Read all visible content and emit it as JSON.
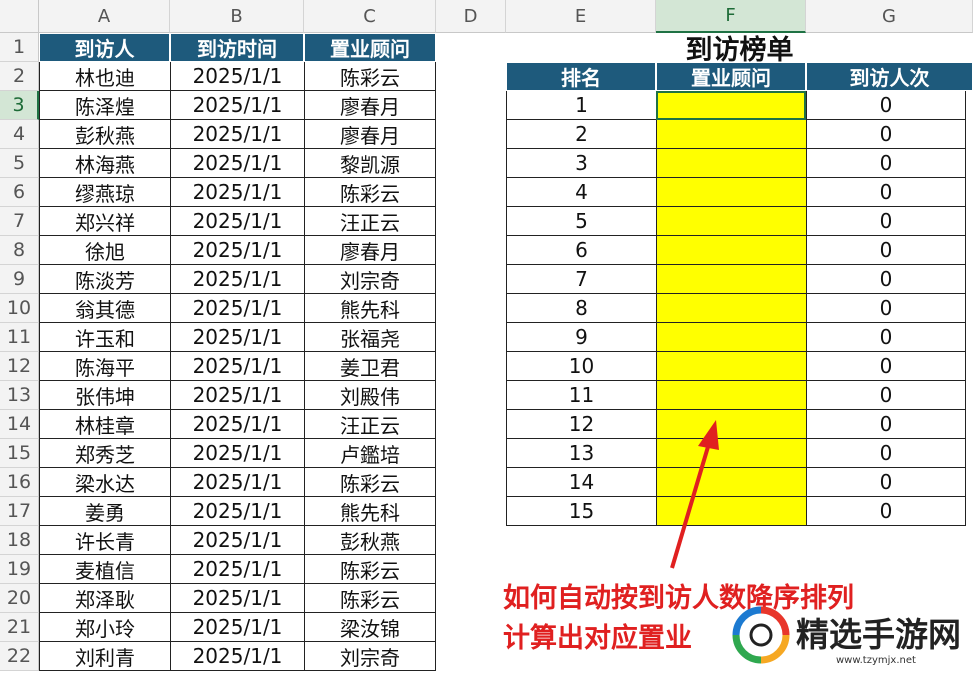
{
  "columns": [
    "A",
    "B",
    "C",
    "D",
    "E",
    "F",
    "G"
  ],
  "selected_column": "F",
  "selected_row": "3",
  "rows": [
    "1",
    "2",
    "3",
    "4",
    "5",
    "6",
    "7",
    "8",
    "9",
    "10",
    "11",
    "12",
    "13",
    "14",
    "15",
    "16",
    "17",
    "18",
    "19",
    "20",
    "21",
    "22"
  ],
  "left_table": {
    "headers": [
      "到访人",
      "到访时间",
      "置业顾问"
    ],
    "rows": [
      [
        "林也迪",
        "2025/1/1",
        "陈彩云"
      ],
      [
        "陈泽煌",
        "2025/1/1",
        "廖春月"
      ],
      [
        "彭秋燕",
        "2025/1/1",
        "廖春月"
      ],
      [
        "林海燕",
        "2025/1/1",
        "黎凯源"
      ],
      [
        "缪燕琼",
        "2025/1/1",
        "陈彩云"
      ],
      [
        "郑兴祥",
        "2025/1/1",
        "汪正云"
      ],
      [
        "徐旭",
        "2025/1/1",
        "廖春月"
      ],
      [
        "陈淡芳",
        "2025/1/1",
        "刘宗奇"
      ],
      [
        "翁其德",
        "2025/1/1",
        "熊先科"
      ],
      [
        "许玉和",
        "2025/1/1",
        "张福尧"
      ],
      [
        "陈海平",
        "2025/1/1",
        "姜卫君"
      ],
      [
        "张伟坤",
        "2025/1/1",
        "刘殿伟"
      ],
      [
        "林桂章",
        "2025/1/1",
        "汪正云"
      ],
      [
        "郑秀芝",
        "2025/1/1",
        "卢鑑培"
      ],
      [
        "梁水达",
        "2025/1/1",
        "陈彩云"
      ],
      [
        "姜勇",
        "2025/1/1",
        "熊先科"
      ],
      [
        "许长青",
        "2025/1/1",
        "彭秋燕"
      ],
      [
        "麦植信",
        "2025/1/1",
        "陈彩云"
      ],
      [
        "郑泽耿",
        "2025/1/1",
        "陈彩云"
      ],
      [
        "郑小玲",
        "2025/1/1",
        "梁汝锦"
      ],
      [
        "刘利青",
        "2025/1/1",
        "刘宗奇"
      ]
    ]
  },
  "ranking": {
    "title": "到访榜单",
    "headers": [
      "排名",
      "置业顾问",
      "到访人次"
    ],
    "ranks": [
      "1",
      "2",
      "3",
      "4",
      "5",
      "6",
      "7",
      "8",
      "9",
      "10",
      "11",
      "12",
      "13",
      "14",
      "15"
    ],
    "advisors": [
      "",
      "",
      "",
      "",
      "",
      "",
      "",
      "",
      "",
      "",
      "",
      "",
      "",
      "",
      ""
    ],
    "counts": [
      "0",
      "0",
      "0",
      "0",
      "0",
      "0",
      "0",
      "0",
      "0",
      "0",
      "0",
      "0",
      "0",
      "0",
      "0"
    ]
  },
  "overlay": {
    "line1": "如何自动按到访人数降序排列",
    "line2": "计算出对应置业",
    "color": "#e02020"
  },
  "watermark": {
    "brand": "精选手游网",
    "url": "www.tzymjx.net"
  },
  "colors": {
    "header_fill": "#1e5a7c",
    "highlight": "#ffff00",
    "excel_green": "#1f7244"
  }
}
